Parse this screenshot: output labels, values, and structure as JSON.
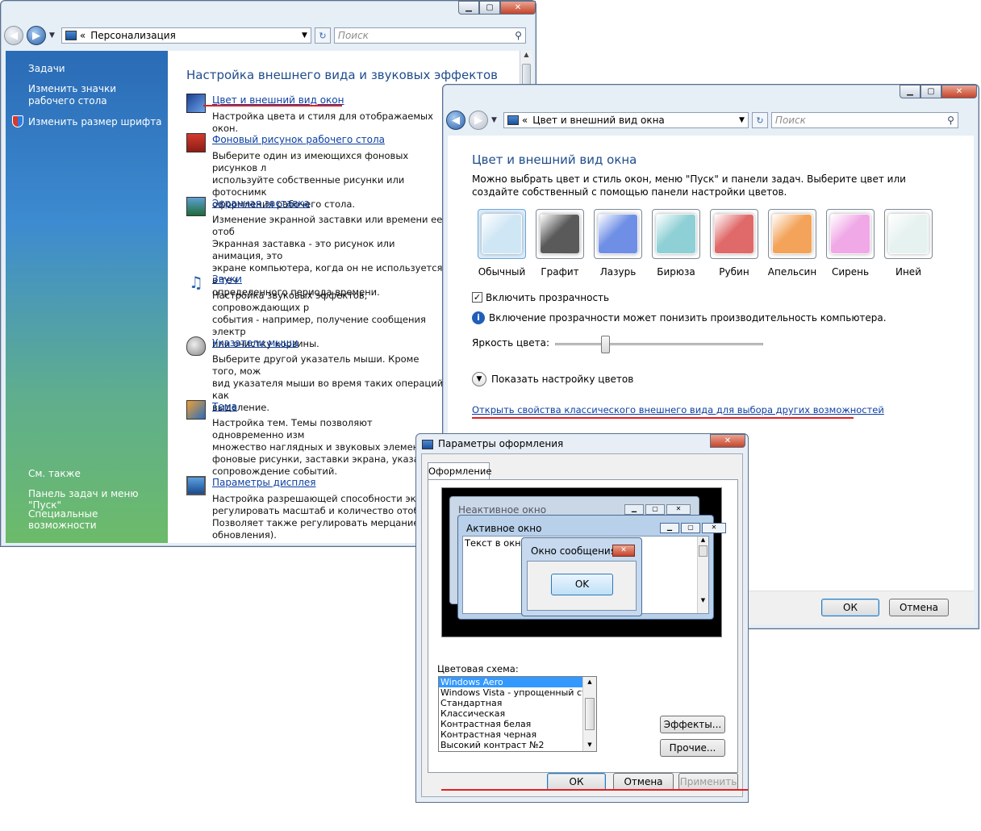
{
  "personalization": {
    "address": "Персонализация",
    "search_placeholder": "Поиск",
    "tasks_header": "Задачи",
    "task_desktop_icons": "Изменить значки рабочего стола",
    "task_font_size": "Изменить размер шрифта",
    "see_also_header": "См. также",
    "see_also_taskbar": "Панель задач и меню \"Пуск\"",
    "see_also_accessibility": "Специальные возможности",
    "main_title": "Настройка внешнего вида и звуковых эффектов",
    "items": [
      {
        "title": "Цвет и внешний вид окон",
        "desc": "Настройка цвета и стиля для отображаемых окон."
      },
      {
        "title": "Фоновый рисунок рабочего стола",
        "desc": "Выберите один из имеющихся фоновых рисунков л\nиспользуйте собственные рисунки или фотоснимк\nоформления рабочего стола."
      },
      {
        "title": "Экранная заставка",
        "desc": "Изменение экранной заставки или времени ее отоб\nЭкранная заставка - это рисунок или анимация, это\nэкране компьютера, когда он не используется в теч\nопределенного периода времени."
      },
      {
        "title": "Звуки",
        "desc": "Настройка звуковых эффектов, сопровождающих р\nсобытия - например, получение сообщения электр\nили очистку корзины."
      },
      {
        "title": "Указатели мыши",
        "desc": "Выберите другой указатель мыши. Кроме того, мож\nвид указателя мыши во время таких операций, как\nвыделение."
      },
      {
        "title": "Тема",
        "desc": "Настройка тем. Темы позволяют одновременно изм\nмножество наглядных и звуковых элементов\nфоновые рисунки, заставки экрана, указател\nсопровождение событий."
      },
      {
        "title": "Параметры дисплея",
        "desc": "Настройка разрешающей способности экра\nрегулировать масштаб и количество отобраз\nПозволяет также регулировать мерцание мо\nобновления)."
      }
    ]
  },
  "color_window": {
    "address": "Цвет и внешний вид окна",
    "search_placeholder": "Поиск",
    "title": "Цвет и внешний вид окна",
    "description": "Можно выбрать цвет и стиль окон, меню \"Пуск\" и панели задач. Выберите цвет или создайте собственный с помощью панели настройки цветов.",
    "swatches": [
      {
        "label": "Обычный",
        "color": "#cfe6f5"
      },
      {
        "label": "Графит",
        "color": "#5a5a5a"
      },
      {
        "label": "Лазурь",
        "color": "#6f8fe6"
      },
      {
        "label": "Бирюза",
        "color": "#8fd0d6"
      },
      {
        "label": "Рубин",
        "color": "#e06a6a"
      },
      {
        "label": "Апельсин",
        "color": "#f3a35a"
      },
      {
        "label": "Сирень",
        "color": "#f0a8e6"
      },
      {
        "label": "Иней",
        "color": "#e6f2f0"
      }
    ],
    "transparency_label": "Включить прозрачность",
    "transparency_checked": true,
    "info_text": "Включение прозрачности может понизить производительность компьютера.",
    "brightness_label": "Яркость цвета:",
    "brightness_level": 0.25,
    "show_mixer": "Показать настройку цветов",
    "classic_link": "Открыть свойства классического внешнего вида для выбора других возможностей",
    "ok": "ОК",
    "cancel": "Отмена"
  },
  "appearance_dialog": {
    "title": "Параметры оформления",
    "tab": "Оформление",
    "preview_inactive": "Неактивное окно",
    "preview_active": "Активное окно",
    "preview_text": "Текст в окне",
    "preview_msgbox": "Окно сообщения",
    "preview_ok": "OK",
    "scheme_label": "Цветовая схема:",
    "schemes": [
      "Windows Aero",
      "Windows Vista - упрощенный стиль",
      "Стандартная",
      "Классическая",
      "Контрастная белая",
      "Контрастная черная",
      "Высокий контраст №2"
    ],
    "selected_scheme": "Windows Aero",
    "effects": "Эффекты...",
    "advanced": "Прочие...",
    "ok": "ОК",
    "cancel": "Отмена",
    "apply": "Применить"
  }
}
